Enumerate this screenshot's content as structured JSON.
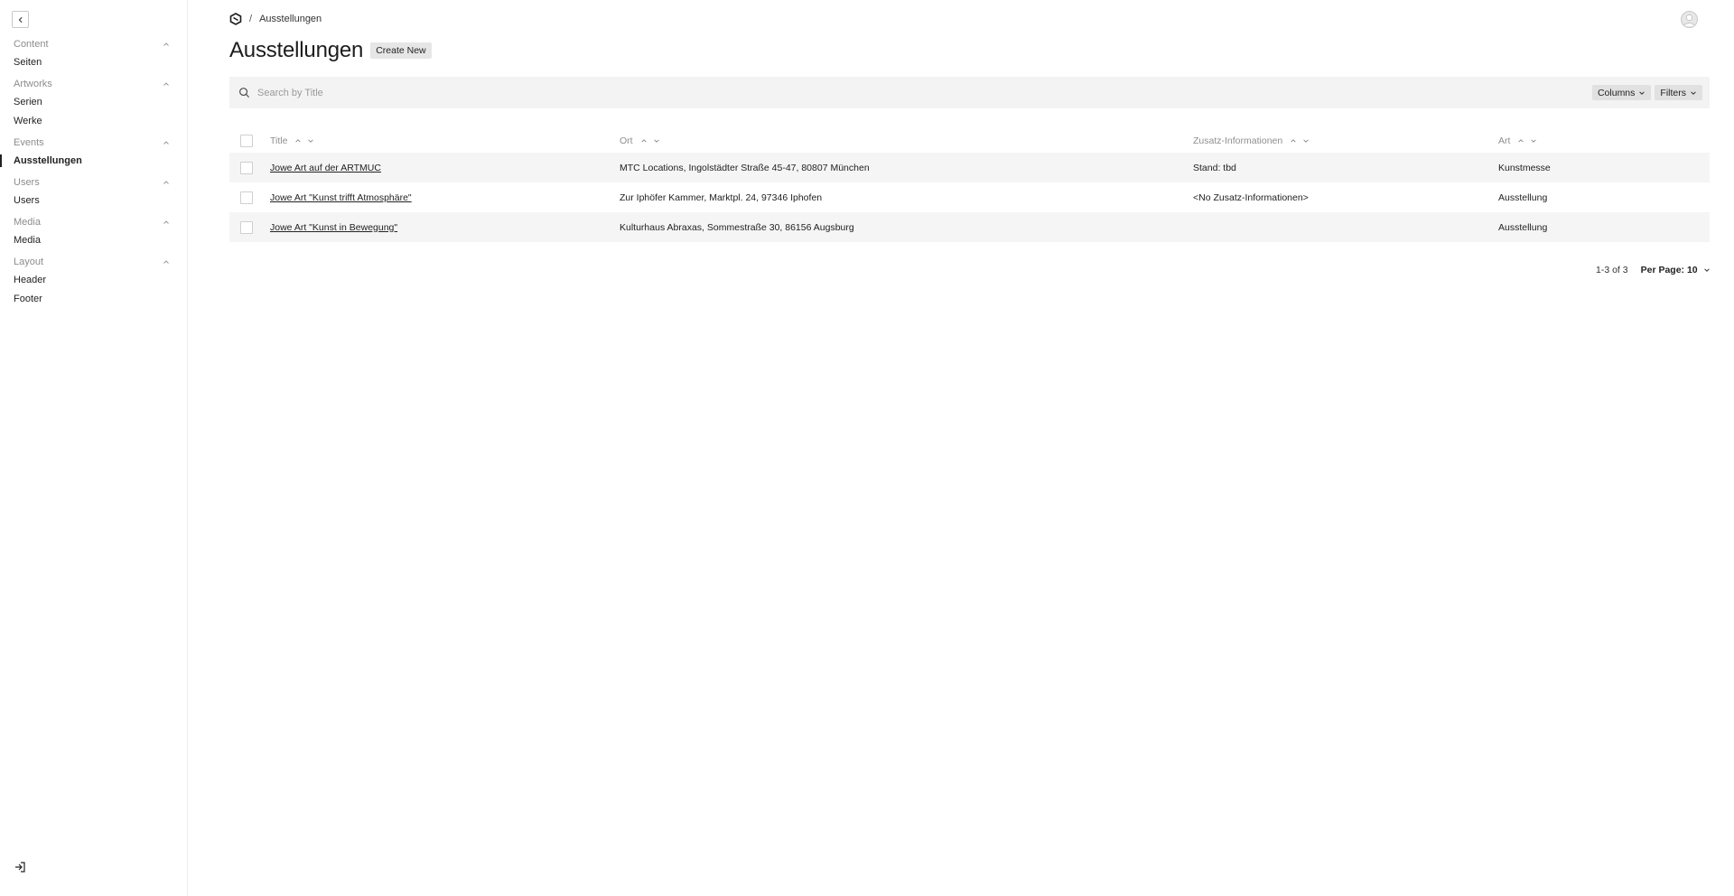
{
  "breadcrumb": {
    "current": "Ausstellungen"
  },
  "sidebar": {
    "groups": [
      {
        "label": "Content",
        "items": [
          {
            "label": "Seiten"
          }
        ]
      },
      {
        "label": "Artworks",
        "items": [
          {
            "label": "Serien"
          },
          {
            "label": "Werke"
          }
        ]
      },
      {
        "label": "Events",
        "items": [
          {
            "label": "Ausstellungen",
            "active": true
          }
        ]
      },
      {
        "label": "Users",
        "items": [
          {
            "label": "Users"
          }
        ]
      },
      {
        "label": "Media",
        "items": [
          {
            "label": "Media"
          }
        ]
      },
      {
        "label": "Layout",
        "items": [
          {
            "label": "Header"
          },
          {
            "label": "Footer"
          }
        ]
      }
    ]
  },
  "page": {
    "title": "Ausstellungen",
    "create_label": "Create New"
  },
  "search": {
    "placeholder": "Search by Title",
    "columns_label": "Columns",
    "filters_label": "Filters"
  },
  "table": {
    "headers": {
      "title": "Title",
      "ort": "Ort",
      "zusatz": "Zusatz-Informationen",
      "art": "Art"
    },
    "rows": [
      {
        "title": "Jowe Art auf der ARTMUC",
        "ort": "MTC Locations, Ingolstädter Straße 45-47, 80807 München",
        "zusatz": "Stand: tbd",
        "art": "Kunstmesse"
      },
      {
        "title": "Jowe Art \"Kunst trifft Atmosphäre\"",
        "ort": "Zur Iphöfer Kammer, Marktpl. 24, 97346 Iphofen",
        "zusatz": "<No Zusatz-Informationen>",
        "art": "Ausstellung"
      },
      {
        "title": "Jowe Art \"Kunst in Bewegung\"",
        "ort": "Kulturhaus Abraxas, Sommestraße 30, 86156 Augsburg",
        "zusatz": "",
        "art": "Ausstellung"
      }
    ]
  },
  "pagination": {
    "range": "1-3 of 3",
    "per_page_label": "Per Page: 10"
  }
}
